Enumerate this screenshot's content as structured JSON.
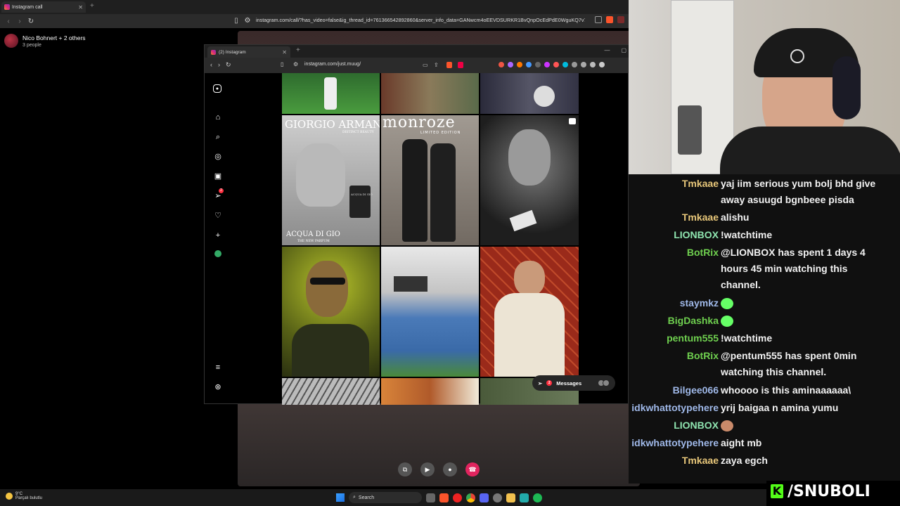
{
  "outer_browser": {
    "tab_title": "Instagram call",
    "url": "instagram.com/call/?has_video=false&ig_thread_id=761366542892860&server_info_data=GANwcm4oEEVDSURKR1BvQnpOcEdPdE0WguKQ7v7ggwgA"
  },
  "call": {
    "title": "Nico Bohnert + 2 others",
    "subtitle": "3 people"
  },
  "inner_browser": {
    "tab_title": "(2) Instagram",
    "url": "instagram.com/just.muug/"
  },
  "instagram": {
    "notifications_badge": "2",
    "messages_label": "Messages",
    "messages_badge": "2",
    "posts": [
      {
        "text_line1": "GIORGIO ARMANI",
        "text_line2": "DISTINCT BEAUTY",
        "text_line3": "ACQUA DI GIO",
        "text_line4": "THE NEW PARFUM",
        "bottle_label": "ACQUA DI GIÒ"
      },
      {
        "text_line1": "monroze",
        "text_line2": "LIMITED EDITION"
      }
    ]
  },
  "chat": {
    "messages": [
      {
        "user": "Tmkaae",
        "color": "#e8c77a",
        "text": "yaj iim serious yum bolj bhd give away asuugd bgnbeee pisda"
      },
      {
        "user": "Tmkaae",
        "color": "#e8c77a",
        "text": "alishu"
      },
      {
        "user": "LIONBOX",
        "color": "#8fe5b0",
        "text": "!watchtime"
      },
      {
        "user": "BotRix",
        "color": "#6fd04f",
        "text": "@LIONBOX has spent 1 days 4 hours 45 min watching this channel."
      },
      {
        "user": "staymkz",
        "color": "#9fb8e8",
        "text": ""
      },
      {
        "user": "BigDashka",
        "color": "#6fd04f",
        "text": ""
      },
      {
        "user": "pentum555",
        "color": "#6fd04f",
        "text": "!watchtime"
      },
      {
        "user": "BotRix",
        "color": "#6fd04f",
        "text": "@pentum555 has spent 0min watching this channel."
      },
      {
        "user": "Bilgee066",
        "color": "#9fb8e8",
        "text": "whoooo is this aminaaaaaa\\"
      },
      {
        "user": "idkwhattotypehere",
        "color": "#9fb8e8",
        "text": "yrij baigaa n amina yumu"
      },
      {
        "user": "LIONBOX",
        "color": "#8fe5b0",
        "text": ""
      },
      {
        "user": "idkwhattotypehere",
        "color": "#9fb8e8",
        "text": "aight mb"
      },
      {
        "user": "Tmkaae",
        "color": "#e8c77a",
        "text": "zaya egch"
      }
    ]
  },
  "brand": "/SNUBOLI",
  "brand_icon": "K",
  "taskbar": {
    "weather_temp": "9°C",
    "weather_desc": "Parçalı bulutlu",
    "search_label": "Search"
  }
}
